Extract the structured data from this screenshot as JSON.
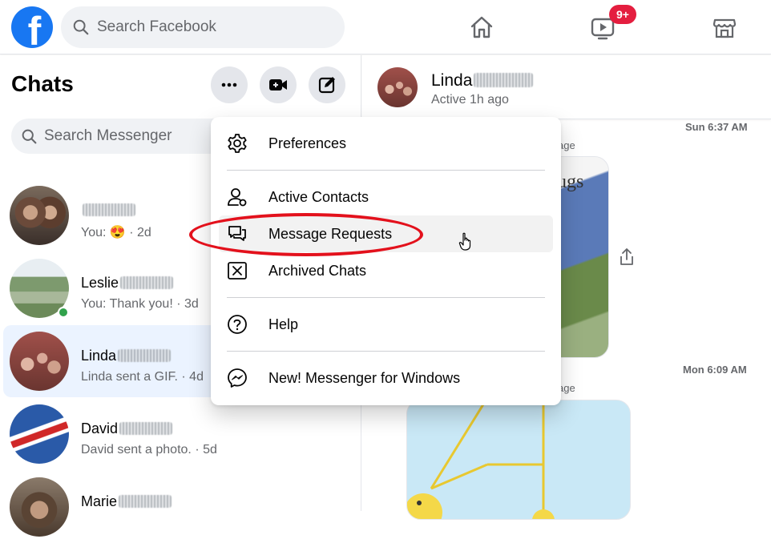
{
  "topbar": {
    "logo_letter": "f",
    "search_placeholder": "Search Facebook",
    "watch_badge": "9+"
  },
  "sidebar": {
    "title": "Chats",
    "search_placeholder": "Search Messenger",
    "chats": [
      {
        "name": "",
        "preview_prefix": "You: ",
        "emoji": "😍",
        "time": " · 2d"
      },
      {
        "name": "Leslie",
        "preview": "You: Thank you! · 3d"
      },
      {
        "name": "Linda",
        "preview": "Linda sent a GIF. · 4d"
      },
      {
        "name": "David",
        "preview": "David sent a photo. · 5d"
      },
      {
        "name": "Marie",
        "preview": ""
      }
    ]
  },
  "conversation": {
    "name": "Linda",
    "status": "Active 1h ago",
    "timestamps": [
      "Sun 6:37 AM",
      "Mon 6:09 AM"
    ],
    "sent_label": "age",
    "card_text": "ugs"
  },
  "menu": {
    "items": [
      {
        "label": "Preferences"
      },
      {
        "label": "Active Contacts"
      },
      {
        "label": "Message Requests"
      },
      {
        "label": "Archived Chats"
      },
      {
        "label": "Help"
      },
      {
        "label": "New! Messenger for Windows"
      }
    ]
  },
  "colors": {
    "brand": "#1877f2",
    "highlight_oval": "#e3111c",
    "badge": "#e41e3f"
  }
}
